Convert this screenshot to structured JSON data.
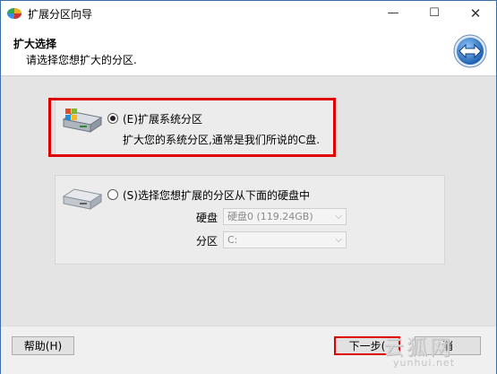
{
  "window": {
    "title": "扩展分区向导"
  },
  "titlebar_buttons": {
    "minimize": "—",
    "maximize": "☐",
    "close": "✕"
  },
  "header": {
    "title": "扩大选择",
    "subtitle": "请选择您想扩大的分区."
  },
  "option1": {
    "label": "(E)扩展系统分区",
    "description": "扩大您的系统分区,通常是我们所说的C盘.",
    "selected": true
  },
  "option2": {
    "label": "(S)选择您想扩展的分区从下面的硬盘中",
    "selected": false,
    "disk_label": "硬盘",
    "disk_value": "硬盘0 (119.24GB)",
    "partition_label": "分区",
    "partition_value": "C:"
  },
  "footer": {
    "help_label": "帮助(H)",
    "next_label": "下一步(",
    "cancel_label": "消"
  },
  "watermark": {
    "main": "云狐网",
    "sub": "yunhui.net"
  },
  "colors": {
    "highlight": "#e00000",
    "accent": "#1e73be"
  }
}
